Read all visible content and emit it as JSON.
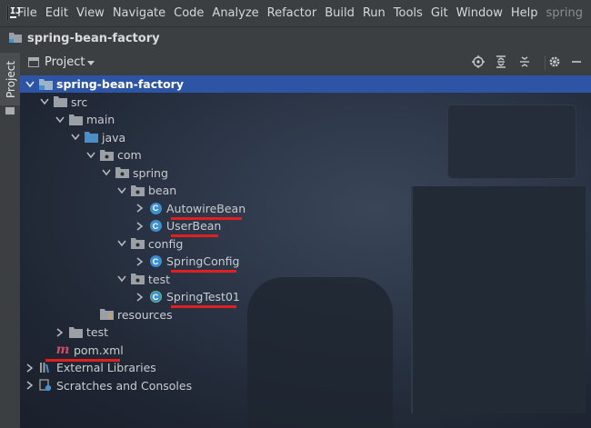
{
  "menu": [
    "File",
    "Edit",
    "View",
    "Navigate",
    "Code",
    "Analyze",
    "Refactor",
    "Build",
    "Run",
    "Tools",
    "Git",
    "Window",
    "Help"
  ],
  "menu_overflow": "spring",
  "breadcrumb": "spring-bean-factory",
  "tool_window_tab": "Project",
  "panel": {
    "title": "Project",
    "actions": [
      "locate-icon",
      "expand-all-icon",
      "collapse-all-icon",
      "gear-icon",
      "minimize-icon"
    ]
  },
  "tree": {
    "root": "spring-bean-factory",
    "src": "src",
    "main": "main",
    "java": "java",
    "com": "com",
    "spring": "spring",
    "bean": "bean",
    "autowire_bean": "AutowireBean",
    "user_bean": "UserBean",
    "config": "config",
    "spring_config": "SpringConfig",
    "test_pkg": "test",
    "spring_test": "SpringTest01",
    "resources": "resources",
    "test_dir": "test",
    "pom": "pom.xml",
    "external_libraries": "External Libraries",
    "scratches": "Scratches and Consoles"
  },
  "colors": {
    "selection": "#2e55a5",
    "underline": "#e02020",
    "class_icon": "#3d8fcf",
    "folder_blue": "#4a90c8"
  }
}
